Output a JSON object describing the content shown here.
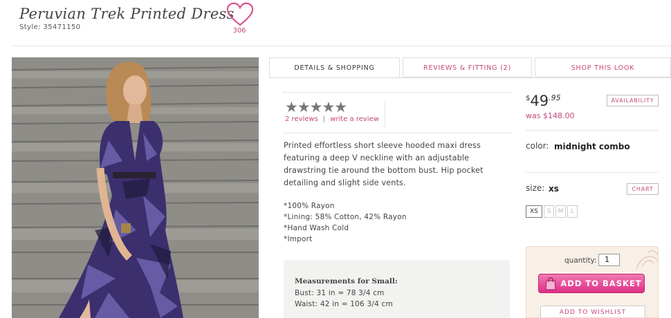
{
  "product": {
    "title": "Peruvian Trek Printed Dress",
    "style": "Style: 35471150",
    "favorites_count": "306",
    "image_alt": "Model on stone steps wearing a purple printed maxi dress"
  },
  "tabs": [
    {
      "label": "DETAILS & SHOPPING",
      "active": true
    },
    {
      "label": "REVIEWS & FITTING (2)",
      "active": false
    },
    {
      "label": "SHOP THIS LOOK",
      "active": false
    }
  ],
  "reviews": {
    "stars": "★★★★★",
    "rating": 5,
    "count_link": "2 reviews",
    "separator": "|",
    "write_link": "write a review"
  },
  "description": "Printed effortless short sleeve hooded maxi dress featuring a deep V neckline with an adjustable drawstring tie around the bottom bust. Hip pocket detailing and slight side vents.",
  "details": [
    "*100% Rayon",
    "*Lining: 58% Cotton, 42% Rayon",
    "*Hand Wash Cold",
    "*Import"
  ],
  "measurements": {
    "title": "Measurements for Small:",
    "bust": "Bust: 31 in = 78 3/4 cm",
    "waist": "Waist: 42 in = 106 3/4 cm"
  },
  "pricing": {
    "currency": "$",
    "dollars": "49",
    "cents": ".95",
    "was": "was $148.00",
    "availability": "AVAILABILITY"
  },
  "color": {
    "label": "color:",
    "value": "midnight combo"
  },
  "size": {
    "label": "size:",
    "value": "xs",
    "chart": "CHART",
    "options": [
      "XS",
      "S",
      "M",
      "L"
    ],
    "selected": "XS"
  },
  "cart": {
    "quantity_label": "quantity:",
    "quantity": "1",
    "add_to_basket": "ADD TO BASKET",
    "add_to_wishlist": "ADD TO WISHLIST"
  },
  "colors": {
    "accent": "#c4487a",
    "button": "#e0398c"
  }
}
